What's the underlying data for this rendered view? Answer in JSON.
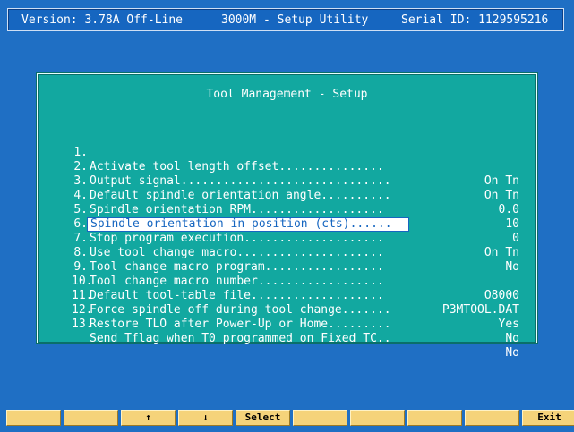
{
  "header": {
    "version": "Version: 3.78A Off-Line",
    "title": "3000M - Setup Utility",
    "serial": "Serial ID: 1129595216"
  },
  "panel": {
    "title": "Tool Management - Setup",
    "items": [
      {
        "num": "1.",
        "label": "Activate tool length offset...............",
        "value": "On Tn"
      },
      {
        "num": "2.",
        "label": "Output signal..............................",
        "value": "On Tn"
      },
      {
        "num": "3.",
        "label": "Default spindle orientation angle..........",
        "value": "0.0"
      },
      {
        "num": "4.",
        "label": "Spindle orientation RPM...................",
        "value": "10"
      },
      {
        "num": "5.",
        "label": "Spindle orientation in position (cts)......",
        "value": "0"
      },
      {
        "num": "6.",
        "label": "Stop program execution....................",
        "value": "On Tn"
      },
      {
        "num": "7.",
        "label": "Use tool change macro.....................",
        "value": "No"
      },
      {
        "num": "8.",
        "label": "Tool change macro program.................",
        "value": ""
      },
      {
        "num": "9.",
        "label": "Tool change macro number..................",
        "value": "O8000"
      },
      {
        "num": "10.",
        "label": "Default tool-table file...................",
        "value": "P3MTOOL.DAT"
      },
      {
        "num": "11.",
        "label": "Force spindle off during tool change.......",
        "value": "Yes"
      },
      {
        "num": "12.",
        "label": "Restore TLO after Power-Up or Home.........",
        "value": "No"
      },
      {
        "num": "13.",
        "label": "Send Tflag when T0 programmed on Fixed TC..",
        "value": "No"
      }
    ]
  },
  "softkeys": [
    "",
    "",
    "↑",
    "↓",
    "Select",
    "",
    "",
    "",
    "",
    "Exit"
  ]
}
